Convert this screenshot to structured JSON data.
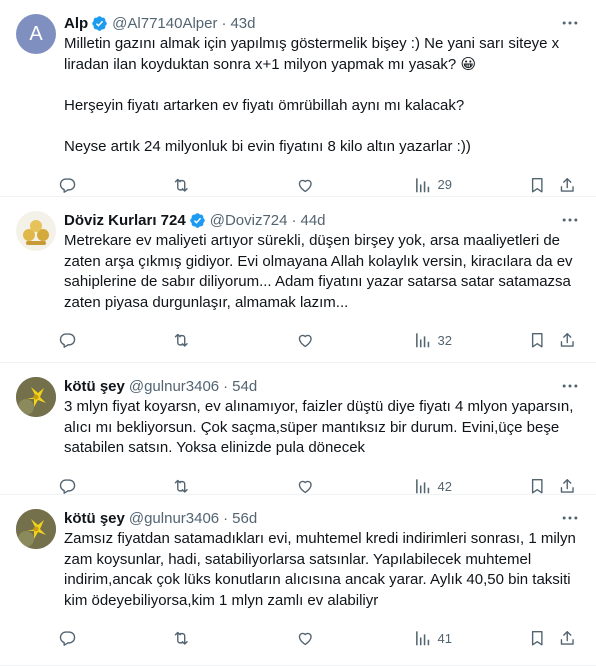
{
  "tweets": [
    {
      "avatar": {
        "type": "letter",
        "letter": "A",
        "color": "#7f8fbf"
      },
      "name": "Alp",
      "handle": "@Al77140Alper",
      "time": "43d",
      "verified": true,
      "text": "Milletin gazını almak için yapılmış göstermelik bişey :) Ne yani sarı siteye x liradan ilan koyduktan sonra x+1 milyon yapmak mı yasak? 😀\n\nHerşeyin fiyatı artarken ev fiyatı ömrübillah aynı mı kalacak?\n\nNeyse artık 24 milyonluk bi evin fiyatını 8 kilo altın yazarlar :))",
      "views": "29"
    },
    {
      "avatar": {
        "type": "image",
        "icon": "money-bags-logo"
      },
      "name": "Döviz Kurları 724",
      "handle": "@Doviz724",
      "time": "44d",
      "verified": true,
      "text": "Metrekare ev maliyeti artıyor sürekli, düşen birşey yok, arsa maaliyetleri de zaten arşa çıkmış gidiyor. Evi olmayana Allah kolaylık versin, kiracılara da ev sahiplerine de sabır diliyorum... Adam fiyatını yazar satarsa satar satamazsa zaten piyasa durgunlaşır, almamak lazım...",
      "views": "32"
    },
    {
      "avatar": {
        "type": "image",
        "icon": "yellow-flower-photo"
      },
      "name": "kötü şey",
      "handle": "@gulnur3406",
      "time": "54d",
      "verified": false,
      "text": "3 mlyn fiyat koyarsn, ev alınamıyor, faizler düştü diye fiyatı 4 mlyon yaparsın, alıcı mı bekliyorsun. Çok saçma,süper mantıksız bir durum. Evini,üçe beşe satabilen satsın. Yoksa elinizde pula dönecek",
      "views": "42"
    },
    {
      "avatar": {
        "type": "image",
        "icon": "yellow-flower-photo"
      },
      "name": "kötü şey",
      "handle": "@gulnur3406",
      "time": "56d",
      "verified": false,
      "text": "Zamsız fiyatdan satamadıkları evi, muhtemel kredi indirimleri sonrası, 1 milyn zam koysunlar, hadi, satabiliyorlarsa satsınlar. Yapılabilecek muhtemel indirim,ancak çok lüks konutların alıcısına ancak yarar. Aylık 40,50 bin taksiti kim ödeyebiliyorsa,kim 1 mlyn zamlı ev alabiliyr",
      "views": "41"
    }
  ]
}
